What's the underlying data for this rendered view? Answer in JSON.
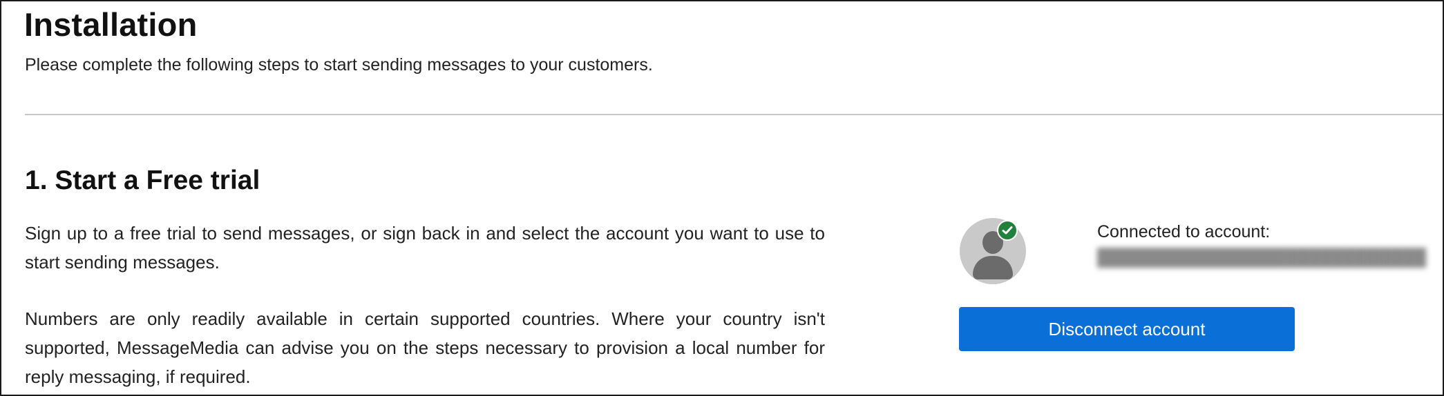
{
  "header": {
    "title": "Installation",
    "subtitle": "Please complete the following steps to start sending messages to your customers."
  },
  "step1": {
    "title": "1. Start a Free trial",
    "paragraph1": "Sign up to a free trial to send messages, or sign back in and select the account you want to use to start sending messages.",
    "paragraph2": "Numbers are only readily available in certain supported countries. Where your country isn't supported, MessageMedia can advise you on the steps necessary to provision a local number for reply messaging, if required."
  },
  "account": {
    "connected_label": "Connected to account:",
    "status_color": "#21803c",
    "avatar_icon": "user-avatar-icon",
    "badge_icon": "check-circle-icon",
    "disconnect_label": "Disconnect account",
    "button_color": "#0a6fd6"
  }
}
